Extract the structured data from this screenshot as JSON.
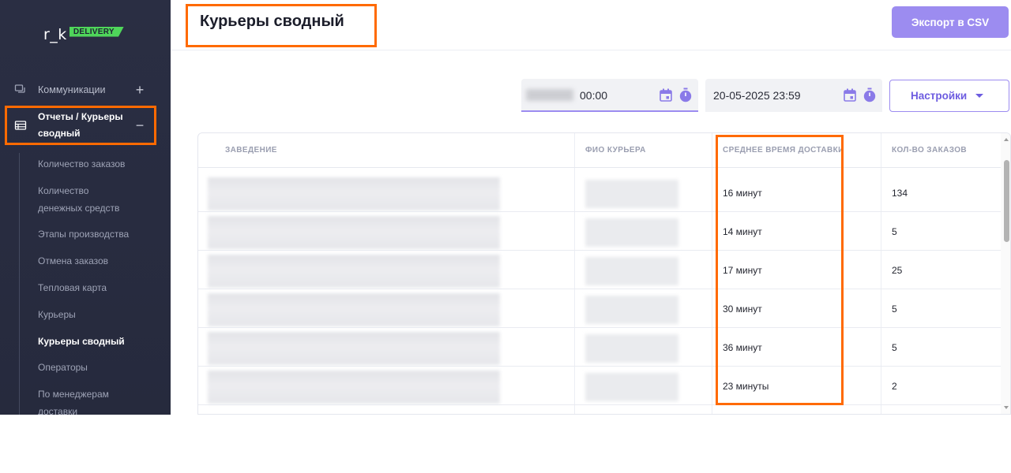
{
  "brand": {
    "logo_text": "r_k",
    "badge": "DELIVERY"
  },
  "sidebar": {
    "communications": "Коммуникации",
    "reports": "Отчеты / Курьеры сводный",
    "sub_items": [
      "Количество заказов",
      "Количество денежных средств",
      "Этапы производства",
      "Отмена заказов",
      "Тепловая карта",
      "Курьеры",
      "Курьеры сводный",
      "Операторы",
      "По менеджерам доставки"
    ],
    "active_index": 6
  },
  "header": {
    "title": "Курьеры сводный",
    "export_label": "Экспорт в CSV"
  },
  "filters": {
    "date_from_visible": "00:00",
    "date_to": "20-05-2025 23:59",
    "settings_label": "Настройки"
  },
  "table": {
    "columns": [
      "ЗАВЕДЕНИЕ",
      "ФИО КУРЬЕРА",
      "СРЕДНЕЕ ВРЕМЯ ДОСТАВКИ",
      "КОЛ-ВО ЗАКАЗОВ"
    ],
    "rows": [
      {
        "avg_time": "16 минут",
        "orders": "134"
      },
      {
        "avg_time": "14 минут",
        "orders": "5"
      },
      {
        "avg_time": "17 минут",
        "orders": "25"
      },
      {
        "avg_time": "30 минут",
        "orders": "5"
      },
      {
        "avg_time": "36 минут",
        "orders": "5"
      },
      {
        "avg_time": "23 минуты",
        "orders": "2"
      }
    ]
  },
  "colors": {
    "accent": "#9c8cf0",
    "highlight": "#ff6a00",
    "sidebar_bg": "#2a2e43",
    "logo_green": "#4fd65a"
  }
}
